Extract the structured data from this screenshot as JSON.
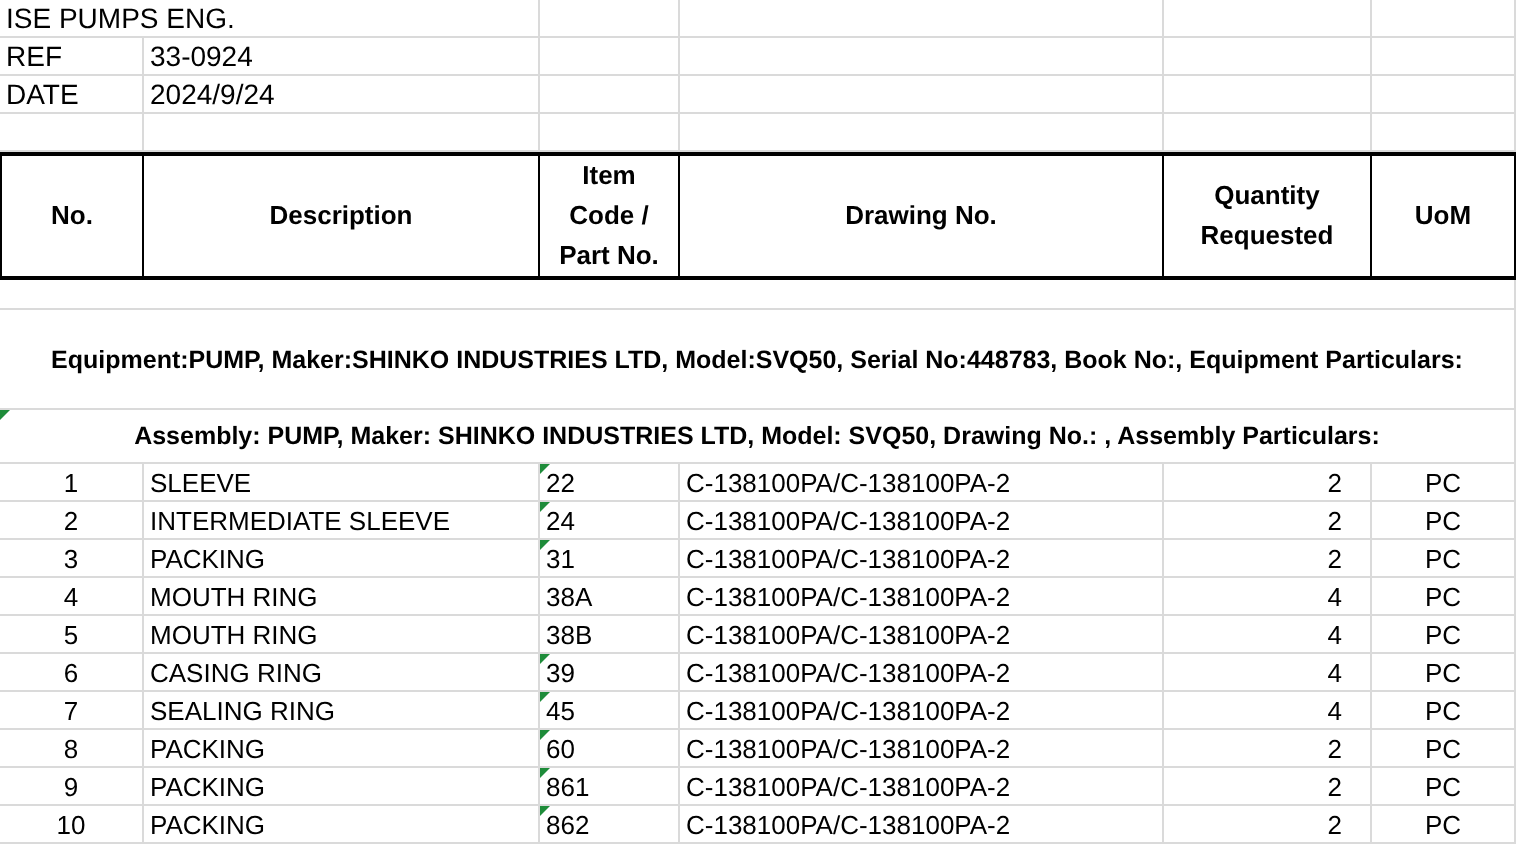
{
  "header": {
    "company": "ISE PUMPS ENG.",
    "ref_label": "REF",
    "ref": "33-0924",
    "date_label": "DATE",
    "date": "2024/9/24"
  },
  "columns": [
    "No.",
    "Description",
    "Item Code / Part No.",
    "Drawing No.",
    "Quantity Requested",
    "UoM"
  ],
  "sections": [
    {
      "text": "Equipment:PUMP, Maker:SHINKO INDUSTRIES LTD, Model:SVQ50, Serial No:448783, Book No:, Equipment Particulars:",
      "flagged": false
    },
    {
      "text": "Assembly: PUMP, Maker: SHINKO INDUSTRIES LTD, Model: SVQ50, Drawing No.: , Assembly Particulars:",
      "flagged": true
    }
  ],
  "rows": [
    {
      "no": "1",
      "description": "SLEEVE",
      "item_code": "22",
      "flagged": true,
      "drawing_no": "C-138100PA/C-138100PA-2",
      "quantity": "2",
      "uom": "PC"
    },
    {
      "no": "2",
      "description": "INTERMEDIATE SLEEVE",
      "item_code": "24",
      "flagged": true,
      "drawing_no": "C-138100PA/C-138100PA-2",
      "quantity": "2",
      "uom": "PC"
    },
    {
      "no": "3",
      "description": "PACKING",
      "item_code": "31",
      "flagged": true,
      "drawing_no": "C-138100PA/C-138100PA-2",
      "quantity": "2",
      "uom": "PC"
    },
    {
      "no": "4",
      "description": "MOUTH RING",
      "item_code": "38A",
      "flagged": false,
      "drawing_no": "C-138100PA/C-138100PA-2",
      "quantity": "4",
      "uom": "PC"
    },
    {
      "no": "5",
      "description": "MOUTH RING",
      "item_code": "38B",
      "flagged": false,
      "drawing_no": "C-138100PA/C-138100PA-2",
      "quantity": "4",
      "uom": "PC"
    },
    {
      "no": "6",
      "description": "CASING RING",
      "item_code": "39",
      "flagged": true,
      "drawing_no": "C-138100PA/C-138100PA-2",
      "quantity": "4",
      "uom": "PC"
    },
    {
      "no": "7",
      "description": "SEALING RING",
      "item_code": "45",
      "flagged": true,
      "drawing_no": "C-138100PA/C-138100PA-2",
      "quantity": "4",
      "uom": "PC"
    },
    {
      "no": "8",
      "description": "PACKING",
      "item_code": "60",
      "flagged": true,
      "drawing_no": "C-138100PA/C-138100PA-2",
      "quantity": "2",
      "uom": "PC"
    },
    {
      "no": "9",
      "description": "PACKING",
      "item_code": "861",
      "flagged": true,
      "drawing_no": "C-138100PA/C-138100PA-2",
      "quantity": "2",
      "uom": "PC"
    },
    {
      "no": "10",
      "description": "PACKING",
      "item_code": "862",
      "flagged": true,
      "drawing_no": "C-138100PA/C-138100PA-2",
      "quantity": "2",
      "uom": "PC"
    }
  ]
}
